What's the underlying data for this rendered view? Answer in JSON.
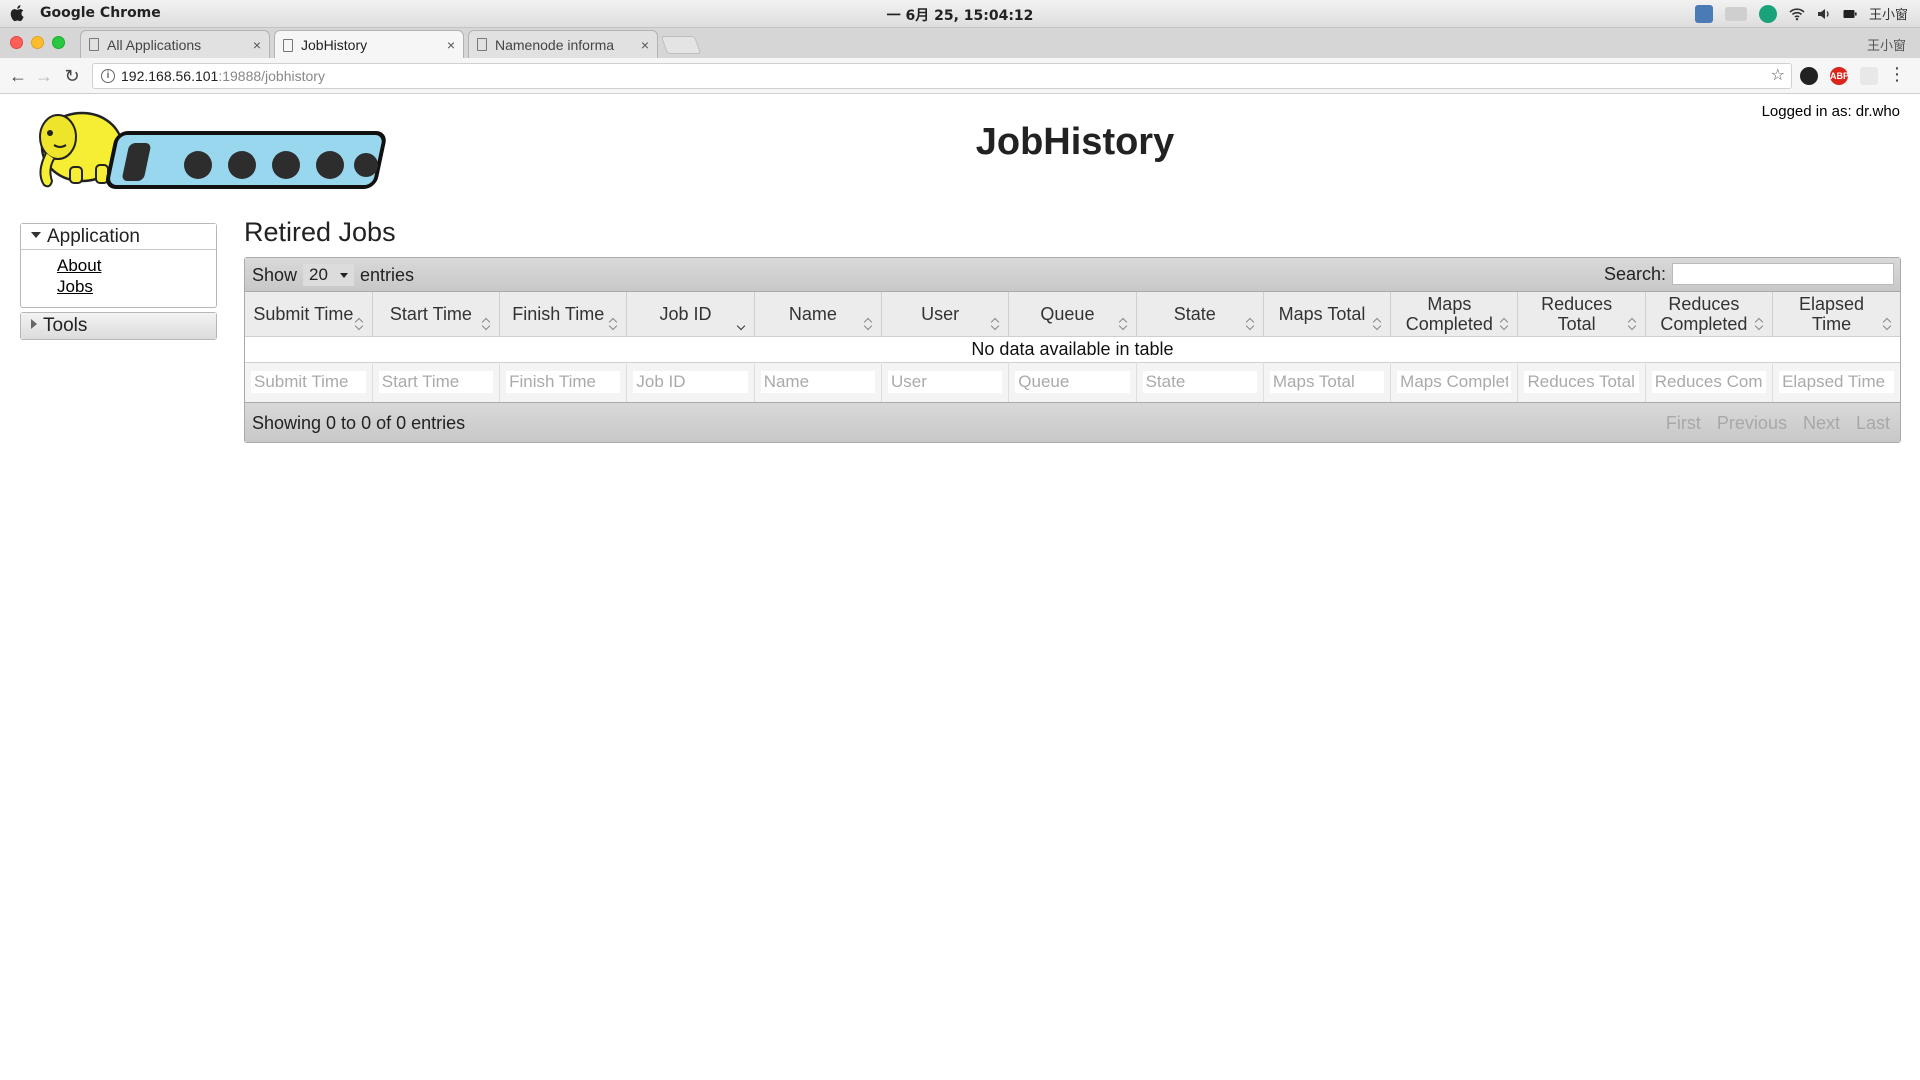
{
  "os": {
    "app_name": "Google Chrome",
    "clock": "一 6月 25, 15:04:12",
    "user": "王小窗"
  },
  "browser": {
    "tabs": [
      {
        "label": "All Applications",
        "close": "×"
      },
      {
        "label": "JobHistory",
        "close": "×"
      },
      {
        "label": "Namenode informa",
        "close": "×"
      }
    ],
    "url_host": "192.168.56.101",
    "url_path": ":19888/jobhistory",
    "ext_abp": "ABP"
  },
  "header": {
    "logged_in": "Logged in as: dr.who",
    "title": "JobHistory"
  },
  "sidebar": {
    "application": {
      "label": "Application",
      "links": [
        "About",
        "Jobs"
      ]
    },
    "tools": {
      "label": "Tools"
    }
  },
  "main": {
    "section_title": "Retired Jobs",
    "length": {
      "show": "Show",
      "value": "20",
      "entries": "entries"
    },
    "search_label": "Search:",
    "search_value": "",
    "columns": [
      "Submit Time",
      "Start Time",
      "Finish Time",
      "Job ID",
      "Name",
      "User",
      "Queue",
      "State",
      "Maps Total",
      "Maps Completed",
      "Reduces Total",
      "Reduces Completed",
      "Elapsed Time"
    ],
    "sorted_column": "Job ID",
    "empty_message": "No data available in table",
    "filters": [
      "Submit Time",
      "Start Time",
      "Finish Time",
      "Job ID",
      "Name",
      "User",
      "Queue",
      "State",
      "Maps Total",
      "Maps Completed",
      "Reduces Total",
      "Reduces Completed",
      "Elapsed Time"
    ],
    "info": "Showing 0 to 0 of 0 entries",
    "paging": {
      "first": "First",
      "previous": "Previous",
      "next": "Next",
      "last": "Last"
    }
  }
}
